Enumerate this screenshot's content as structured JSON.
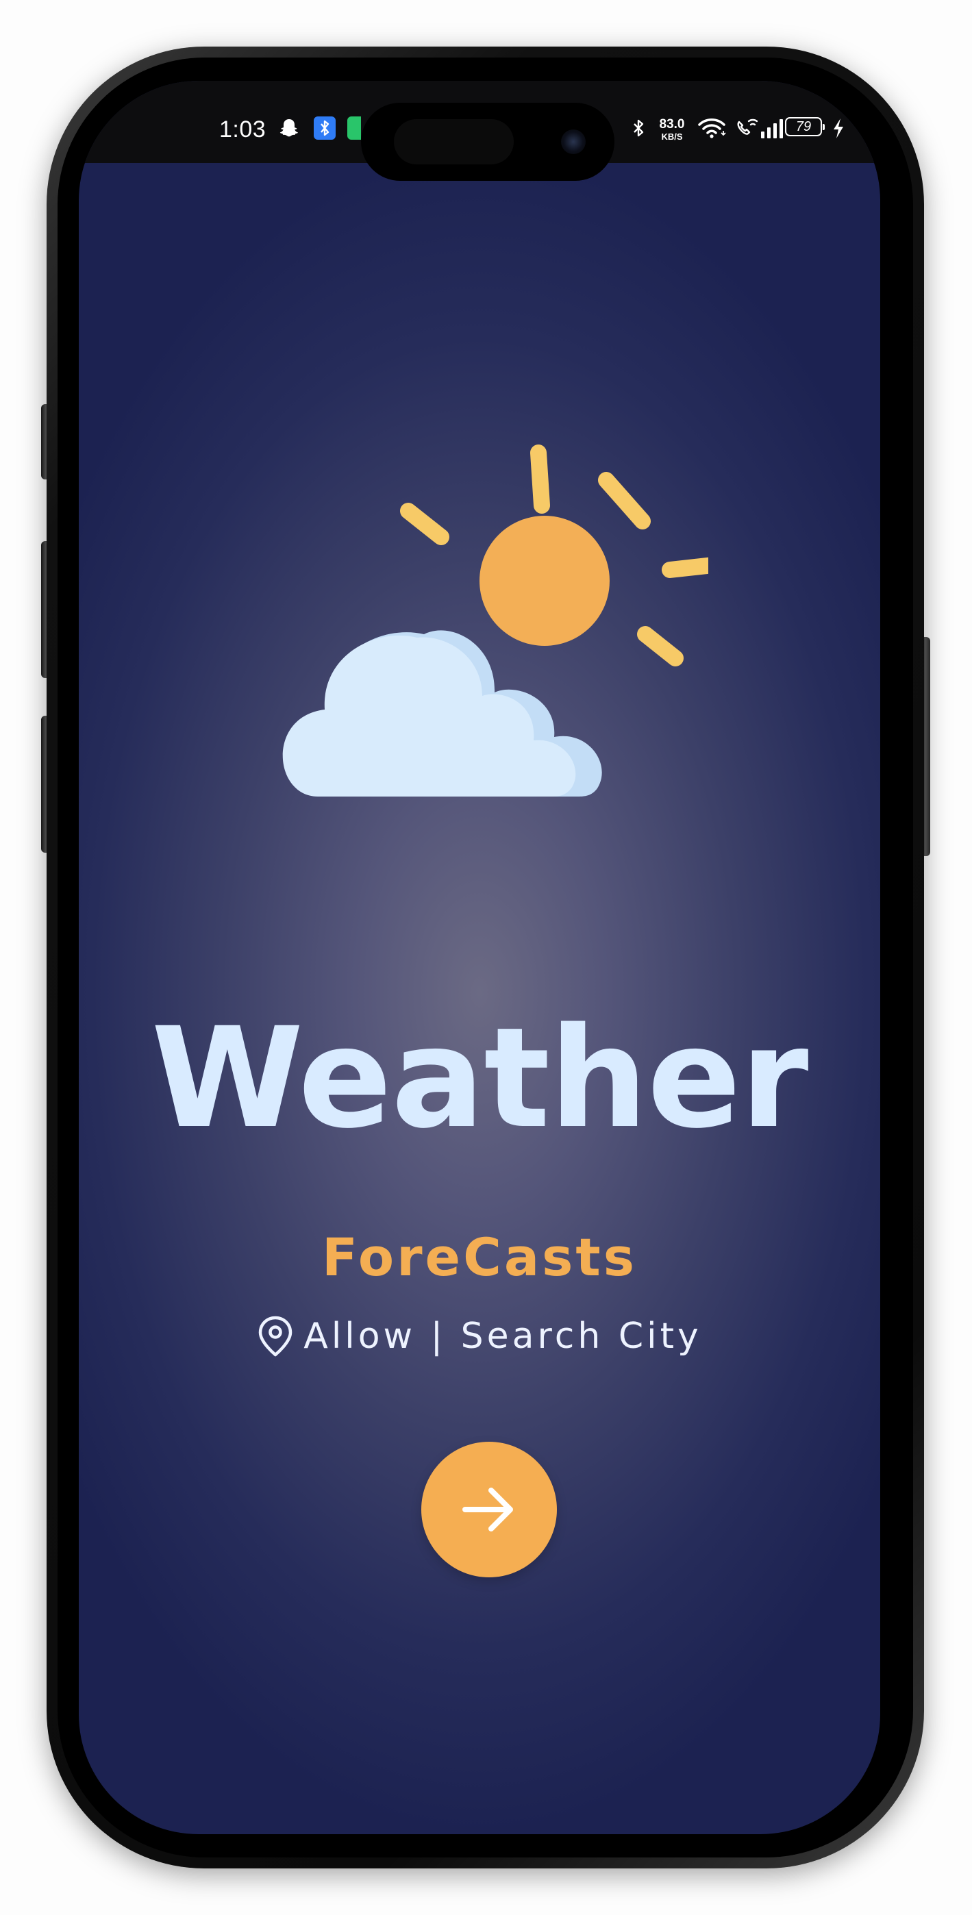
{
  "status_bar": {
    "time": "1:03",
    "network_speed_value": "83.0",
    "network_speed_unit": "KB/S",
    "battery_level": "79",
    "icons": [
      "snapchat-icon",
      "bluetooth-app-icon",
      "app-notification-icon",
      "bluetooth-icon",
      "wifi-icon",
      "wifi-calling-icon",
      "signal-icon",
      "battery-icon",
      "charging-icon"
    ]
  },
  "hero": {
    "illustration": "partly-cloudy-icon",
    "colors": {
      "sun": "#F3AF56",
      "sun_rays": "#F7CA67",
      "cloud": "#D8EBFC",
      "cloud_shade": "#C0DCF5"
    }
  },
  "app": {
    "title": "Weather",
    "subtitle": "ForeCasts",
    "location_prompt": "Allow | Search City"
  },
  "actions": {
    "next_button_icon": "arrow-right-icon"
  },
  "theme": {
    "background_center": "#6B6A84",
    "background_edge": "#1C2251",
    "title_color": "#D9EBFF",
    "accent": "#F5AE52",
    "text_light": "#EEF3FF"
  }
}
